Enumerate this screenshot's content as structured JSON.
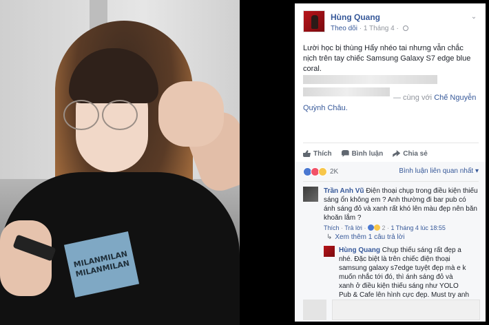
{
  "post": {
    "author": "Hùng Quang",
    "follow": "Theo dõi",
    "date": "1 Tháng 4",
    "separator": "·",
    "text_line1": "Lười học bị thùng Hẩy nhéo tai nhưng vẫn chắc",
    "text_line2": "nịch trên tay chiếc Samsung Galaxy S7 edge blue",
    "text_line3": "coral.",
    "with_prefix": "— cùng với",
    "with_name1": "Chế Nguyễn",
    "with_name2": "Quỳnh Châu."
  },
  "photo": {
    "patch_line1": "MILANMILAN",
    "patch_line2": "MILANMILAN"
  },
  "actions": {
    "like": "Thích",
    "comment": "Bình luận",
    "share": "Chia sẻ"
  },
  "reactions": {
    "count": "2K",
    "sort": "Bình luận liên quan nhất"
  },
  "comment1": {
    "name": "Trần Anh Vũ",
    "text": "Điện thoại chụp trong điều kiện thiếu sáng ổn không em ? Anh thường đi bar pub có ánh sáng đỏ và xanh rất khó lên màu đẹp nên băn khoăn lắm ?",
    "like": "Thích",
    "reply": "Trả lời",
    "rx_count": "2",
    "time": "1 Tháng 4 lúc 18:55"
  },
  "reply_row": {
    "text": "Xem thêm 1 câu trả lời"
  },
  "comment2": {
    "name": "Hùng Quang",
    "text": "Chụp thiếu sáng rất đẹp a nhé. Đặc biệt là trên chiếc điện thoại samsung galaxy s7edge tuyệt đẹp mà e k muốn nhắc tới đó, thì ánh sáng đỏ và xanh ở điều kiện thiếu sáng như YOLO Pub & Cafe lên hình cực đẹp. Must try anh á !!!"
  }
}
